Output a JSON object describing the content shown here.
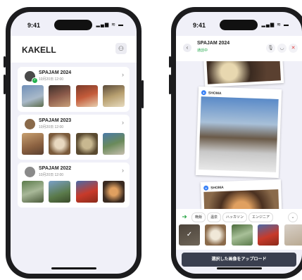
{
  "status": {
    "time": "9:41",
    "icons": "signal wifi battery"
  },
  "left": {
    "app_title": "KAKELL",
    "header_icon": "person-add-icon",
    "events": [
      {
        "name": "SPAJAM 2024",
        "date": "10月20日 12:00"
      },
      {
        "name": "SPAJAM 2023",
        "date": "10月20日 12:00"
      },
      {
        "name": "SPAJAM 2022",
        "date": "10月20日 12:00"
      }
    ]
  },
  "right": {
    "event_title": "SPAJAM 2024",
    "status_text": "通話中",
    "feed_user_1": "SHOMA",
    "feed_user_2": "SHOMA",
    "tags": [
      "晩飯",
      "温泉",
      "ハッカソン",
      "エンジニア"
    ],
    "upload_button": "選択した画像をアップロード"
  },
  "colors": {
    "accent": "#22a84a",
    "mic_bubble": "#3b82f6",
    "dark_button": "#3a3f4f",
    "bg": "#f0f0f8"
  }
}
